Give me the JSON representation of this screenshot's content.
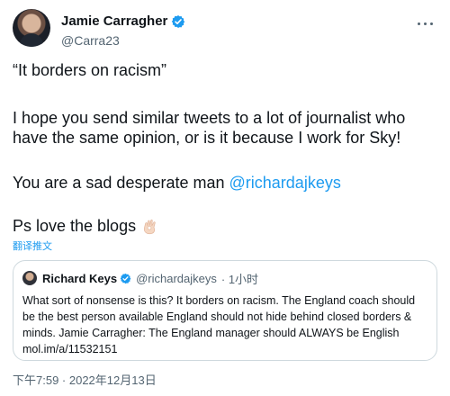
{
  "tweet": {
    "author": {
      "name": "Jamie Carragher",
      "handle": "@Carra23"
    },
    "paragraphs": {
      "p1": "“It borders on racism”",
      "p2": "I hope you send similar tweets to a lot of journalist who have the same opinion, or is it because I work for Sky!",
      "p3_prefix": "You are a sad desperate man ",
      "p3_mention": "@richardajkeys",
      "p4": "Ps love the blogs"
    },
    "translate_label": "翻译推文",
    "timestamp": "下午7:59 · 2022年12月13日"
  },
  "quote": {
    "name": "Richard Keys",
    "handle": "@richardajkeys",
    "time": "· 1小时",
    "text": "What sort of nonsense is this? It borders on racism. The England coach should be the best person available England should not hide behind closed borders & minds. Jamie Carragher: The England manager should ALWAYS be English mol.im/a/11532151"
  },
  "icons": {
    "verified": "verified-badge-icon",
    "more": "more-options-icon",
    "emoji": "ok-hand-emoji-icon"
  },
  "colors": {
    "accent": "#1d9bf0",
    "text": "#0f1419",
    "muted": "#536471",
    "border": "#cfd9de"
  }
}
